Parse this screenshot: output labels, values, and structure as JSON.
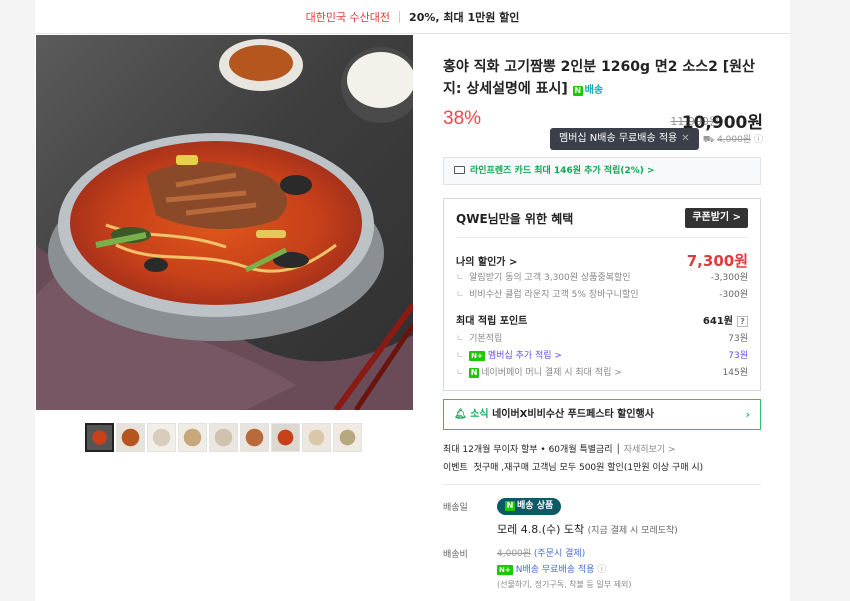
{
  "banner": {
    "event": "대한민국 수산대전",
    "discount": "20%, 최대 1만원 할인"
  },
  "product": {
    "title": "홍야 직화 고기짬뽕 2인분 1260g 면2 소스2 [원산지: 상세설명에 표시]",
    "ship_tag": "배송",
    "discount_rate": "38%",
    "original_price": "11,900원",
    "sale_price": "10,900원",
    "tooltip": "멤버십 N배송 무료배송 적용",
    "shipping_fee_struck": "4,000원"
  },
  "card_benefit": "라인프렌즈 카드 최대 146원 추가 적립(2%) >",
  "benefits": {
    "heading": "QWE님만을 위한 혜택",
    "coupon_button": "쿠폰받기 >",
    "my_discount_label": "나의 할인가 >",
    "my_discount_value": "7,300원",
    "disc1_label": "알림받기 동의 고객 3,300원 상품중복할인",
    "disc1_value": "-3,300원",
    "disc2_label": "비비수산 클럽 라운지 고객 5% 장바구니할인",
    "disc2_value": "-300원",
    "points_label": "최대 적립 포인트",
    "points_value": "641원",
    "point1_label": "기본적립",
    "point1_value": "73원",
    "point2_label": "멤버십 추가 적립 >",
    "point2_value": "73원",
    "point3_label": "네이버페이 머니 결제 시 최대 적립 >",
    "point3_value": "145원"
  },
  "notice": {
    "prefix": "소식",
    "text": "네이버X비비수산 푸드페스타 할인행사"
  },
  "installment": {
    "text": "최대 12개월 무이자 할부 • 60개월 특별금리",
    "link": "자세히보기 >"
  },
  "event": {
    "label": "이벤트",
    "text": "첫구매 ,재구매 고객님 모두 500원 할인(1만원 이상 구매 시)"
  },
  "delivery": {
    "date_label": "배송일",
    "badge": "배송 상품",
    "arrival": "모레 4.8.(수) 도착",
    "arrival_note": "(지금 결제 시 모레도착)",
    "fee_label": "배송비",
    "fee_struck": "4,000원",
    "fee_note": "(주문시 결제)",
    "membership": "N배송 무료배송 적용",
    "exclusions": "(선물하기, 정기구독, 착불 등 일부 제외)"
  }
}
